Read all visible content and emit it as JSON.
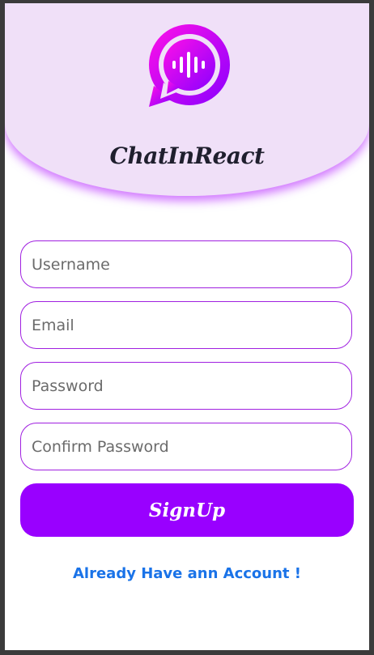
{
  "app": {
    "name": "ChatInReact",
    "logo_icon": "chat-bubble-soundwave-icon",
    "accent_color": "#9900ff",
    "header_color": "#f0e0f8",
    "link_color": "#1a73e8"
  },
  "form": {
    "username_placeholder": "Username",
    "email_placeholder": "Email",
    "password_placeholder": "Password",
    "confirm_password_placeholder": "Confirm Password",
    "submit_label": "SignUp"
  },
  "footer": {
    "login_link": "Already Have ann Account !"
  }
}
